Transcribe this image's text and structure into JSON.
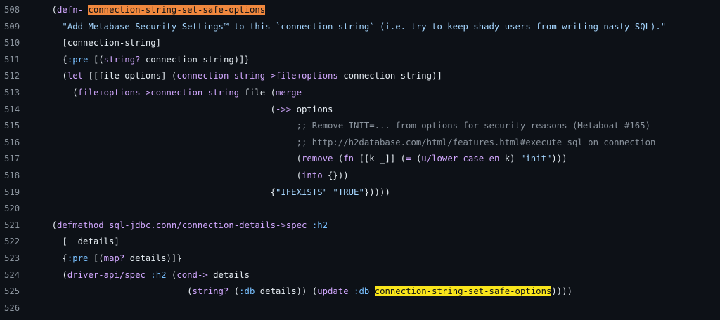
{
  "editor": {
    "highlight_colors": {
      "definition": "#f0883e",
      "reference": "#f9e51b"
    },
    "lines": [
      {
        "num": "508",
        "tokens": [
          {
            "t": "    (",
            "c": ""
          },
          {
            "t": "defn-",
            "c": "tok-k"
          },
          {
            "t": " ",
            "c": ""
          },
          {
            "t": "connection-string-set-safe-options",
            "c": "hl-orange"
          }
        ]
      },
      {
        "num": "509",
        "tokens": [
          {
            "t": "      ",
            "c": ""
          },
          {
            "t": "\"Add Metabase Security Settings™ to this `connection-string` (i.e. try to keep shady users from writing nasty SQL).\"",
            "c": "tok-s"
          }
        ]
      },
      {
        "num": "510",
        "tokens": [
          {
            "t": "      [connection-string]",
            "c": ""
          }
        ]
      },
      {
        "num": "511",
        "tokens": [
          {
            "t": "      {",
            "c": ""
          },
          {
            "t": ":pre",
            "c": "tok-b"
          },
          {
            "t": " [(",
            "c": ""
          },
          {
            "t": "string?",
            "c": "tok-k"
          },
          {
            "t": " connection-string)]}",
            "c": ""
          }
        ]
      },
      {
        "num": "512",
        "tokens": [
          {
            "t": "      (",
            "c": ""
          },
          {
            "t": "let",
            "c": "tok-k"
          },
          {
            "t": " [[file options] (",
            "c": ""
          },
          {
            "t": "connection-string->file+options",
            "c": "tok-k"
          },
          {
            "t": " connection-string)]",
            "c": ""
          }
        ]
      },
      {
        "num": "513",
        "tokens": [
          {
            "t": "        (",
            "c": ""
          },
          {
            "t": "file+options->connection-string",
            "c": "tok-k"
          },
          {
            "t": " file (",
            "c": ""
          },
          {
            "t": "merge",
            "c": "tok-k"
          }
        ]
      },
      {
        "num": "514",
        "tokens": [
          {
            "t": "                                              (",
            "c": ""
          },
          {
            "t": "->>",
            "c": "tok-k"
          },
          {
            "t": " options",
            "c": ""
          }
        ]
      },
      {
        "num": "515",
        "tokens": [
          {
            "t": "                                                   ",
            "c": ""
          },
          {
            "t": ";; Remove INIT=... from options for security reasons (Metaboat #165)",
            "c": "tok-c"
          }
        ]
      },
      {
        "num": "516",
        "tokens": [
          {
            "t": "                                                   ",
            "c": ""
          },
          {
            "t": ";; http://h2database.com/html/features.html#execute_sql_on_connection",
            "c": "tok-c"
          }
        ]
      },
      {
        "num": "517",
        "tokens": [
          {
            "t": "                                                   (",
            "c": ""
          },
          {
            "t": "remove",
            "c": "tok-k"
          },
          {
            "t": " (",
            "c": ""
          },
          {
            "t": "fn",
            "c": "tok-k"
          },
          {
            "t": " [[k _]] (",
            "c": ""
          },
          {
            "t": "=",
            "c": "tok-k"
          },
          {
            "t": " (",
            "c": ""
          },
          {
            "t": "u/lower-case-en",
            "c": "tok-k"
          },
          {
            "t": " k) ",
            "c": ""
          },
          {
            "t": "\"init\"",
            "c": "tok-s"
          },
          {
            "t": ")))",
            "c": ""
          }
        ]
      },
      {
        "num": "518",
        "tokens": [
          {
            "t": "                                                   (",
            "c": ""
          },
          {
            "t": "into",
            "c": "tok-k"
          },
          {
            "t": " {}))",
            "c": ""
          }
        ]
      },
      {
        "num": "519",
        "tokens": [
          {
            "t": "                                              {",
            "c": ""
          },
          {
            "t": "\"IFEXISTS\"",
            "c": "tok-s"
          },
          {
            "t": " ",
            "c": ""
          },
          {
            "t": "\"TRUE\"",
            "c": "tok-s"
          },
          {
            "t": "}))))",
            "c": ""
          }
        ]
      },
      {
        "num": "520",
        "tokens": []
      },
      {
        "num": "521",
        "tokens": [
          {
            "t": "    (",
            "c": ""
          },
          {
            "t": "defmethod",
            "c": "tok-k"
          },
          {
            "t": " ",
            "c": ""
          },
          {
            "t": "sql-jdbc.conn/connection-details->spec",
            "c": "tok-n"
          },
          {
            "t": " ",
            "c": ""
          },
          {
            "t": ":h2",
            "c": "tok-b"
          }
        ]
      },
      {
        "num": "522",
        "tokens": [
          {
            "t": "      [_ details]",
            "c": ""
          }
        ]
      },
      {
        "num": "523",
        "tokens": [
          {
            "t": "      {",
            "c": ""
          },
          {
            "t": ":pre",
            "c": "tok-b"
          },
          {
            "t": " [(",
            "c": ""
          },
          {
            "t": "map?",
            "c": "tok-k"
          },
          {
            "t": " details)]}",
            "c": ""
          }
        ]
      },
      {
        "num": "524",
        "tokens": [
          {
            "t": "      (",
            "c": ""
          },
          {
            "t": "driver-api/spec",
            "c": "tok-k"
          },
          {
            "t": " ",
            "c": ""
          },
          {
            "t": ":h2",
            "c": "tok-b"
          },
          {
            "t": " (",
            "c": ""
          },
          {
            "t": "cond->",
            "c": "tok-k"
          },
          {
            "t": " details",
            "c": ""
          }
        ]
      },
      {
        "num": "525",
        "tokens": [
          {
            "t": "                              (",
            "c": ""
          },
          {
            "t": "string?",
            "c": "tok-k"
          },
          {
            "t": " (",
            "c": ""
          },
          {
            "t": ":db",
            "c": "tok-b"
          },
          {
            "t": " details)) (",
            "c": ""
          },
          {
            "t": "update",
            "c": "tok-k"
          },
          {
            "t": " ",
            "c": ""
          },
          {
            "t": ":db",
            "c": "tok-b"
          },
          {
            "t": " ",
            "c": ""
          },
          {
            "t": "connection-string-set-safe-options",
            "c": "hl-yellow"
          },
          {
            "t": "))))",
            "c": ""
          }
        ]
      },
      {
        "num": "526",
        "tokens": []
      }
    ]
  }
}
